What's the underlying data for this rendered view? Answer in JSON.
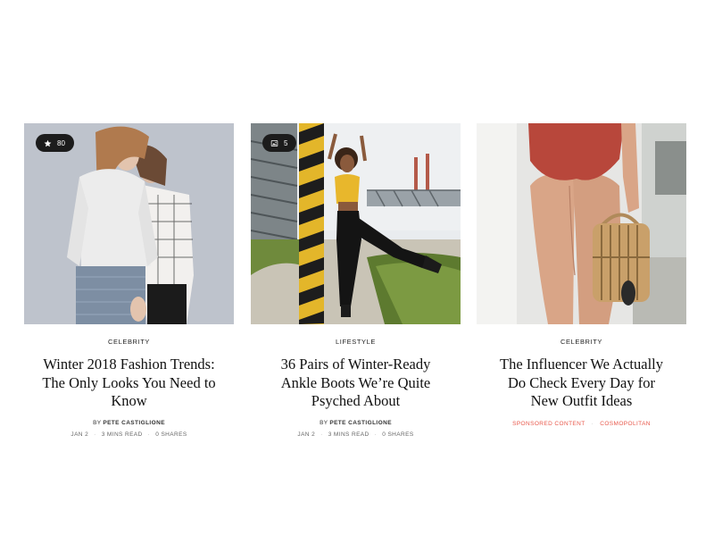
{
  "articles": [
    {
      "category": "Celebrity",
      "title": "Winter 2018 Fashion Trends: The Only Looks You Need to Know",
      "byline_prefix": "BY",
      "author": "PETE CASTIGLIONE",
      "date": "JAN 2",
      "read_time": "3 MINS READ",
      "shares": "0 SHARES",
      "badge": {
        "icon": "star-icon",
        "count": "80"
      }
    },
    {
      "category": "Lifestyle",
      "title": "36 Pairs of Winter-Ready Ankle Boots We’re Quite Psyched About",
      "byline_prefix": "BY",
      "author": "PETE CASTIGLIONE",
      "date": "JAN 2",
      "read_time": "3 MINS READ",
      "shares": "0 SHARES",
      "badge": {
        "icon": "gallery-icon",
        "count": "5"
      }
    },
    {
      "category": "Celebrity",
      "title": "The Influencer We Actually Do Check Every Day for New Outfit Ideas",
      "sponsored_label": "SPONSORED CONTENT",
      "sponsor_name": "COSMOPOLITAN"
    }
  ],
  "colors": {
    "badge_bg": "#1c1c1c",
    "sponsored_red": "#e8574a"
  }
}
